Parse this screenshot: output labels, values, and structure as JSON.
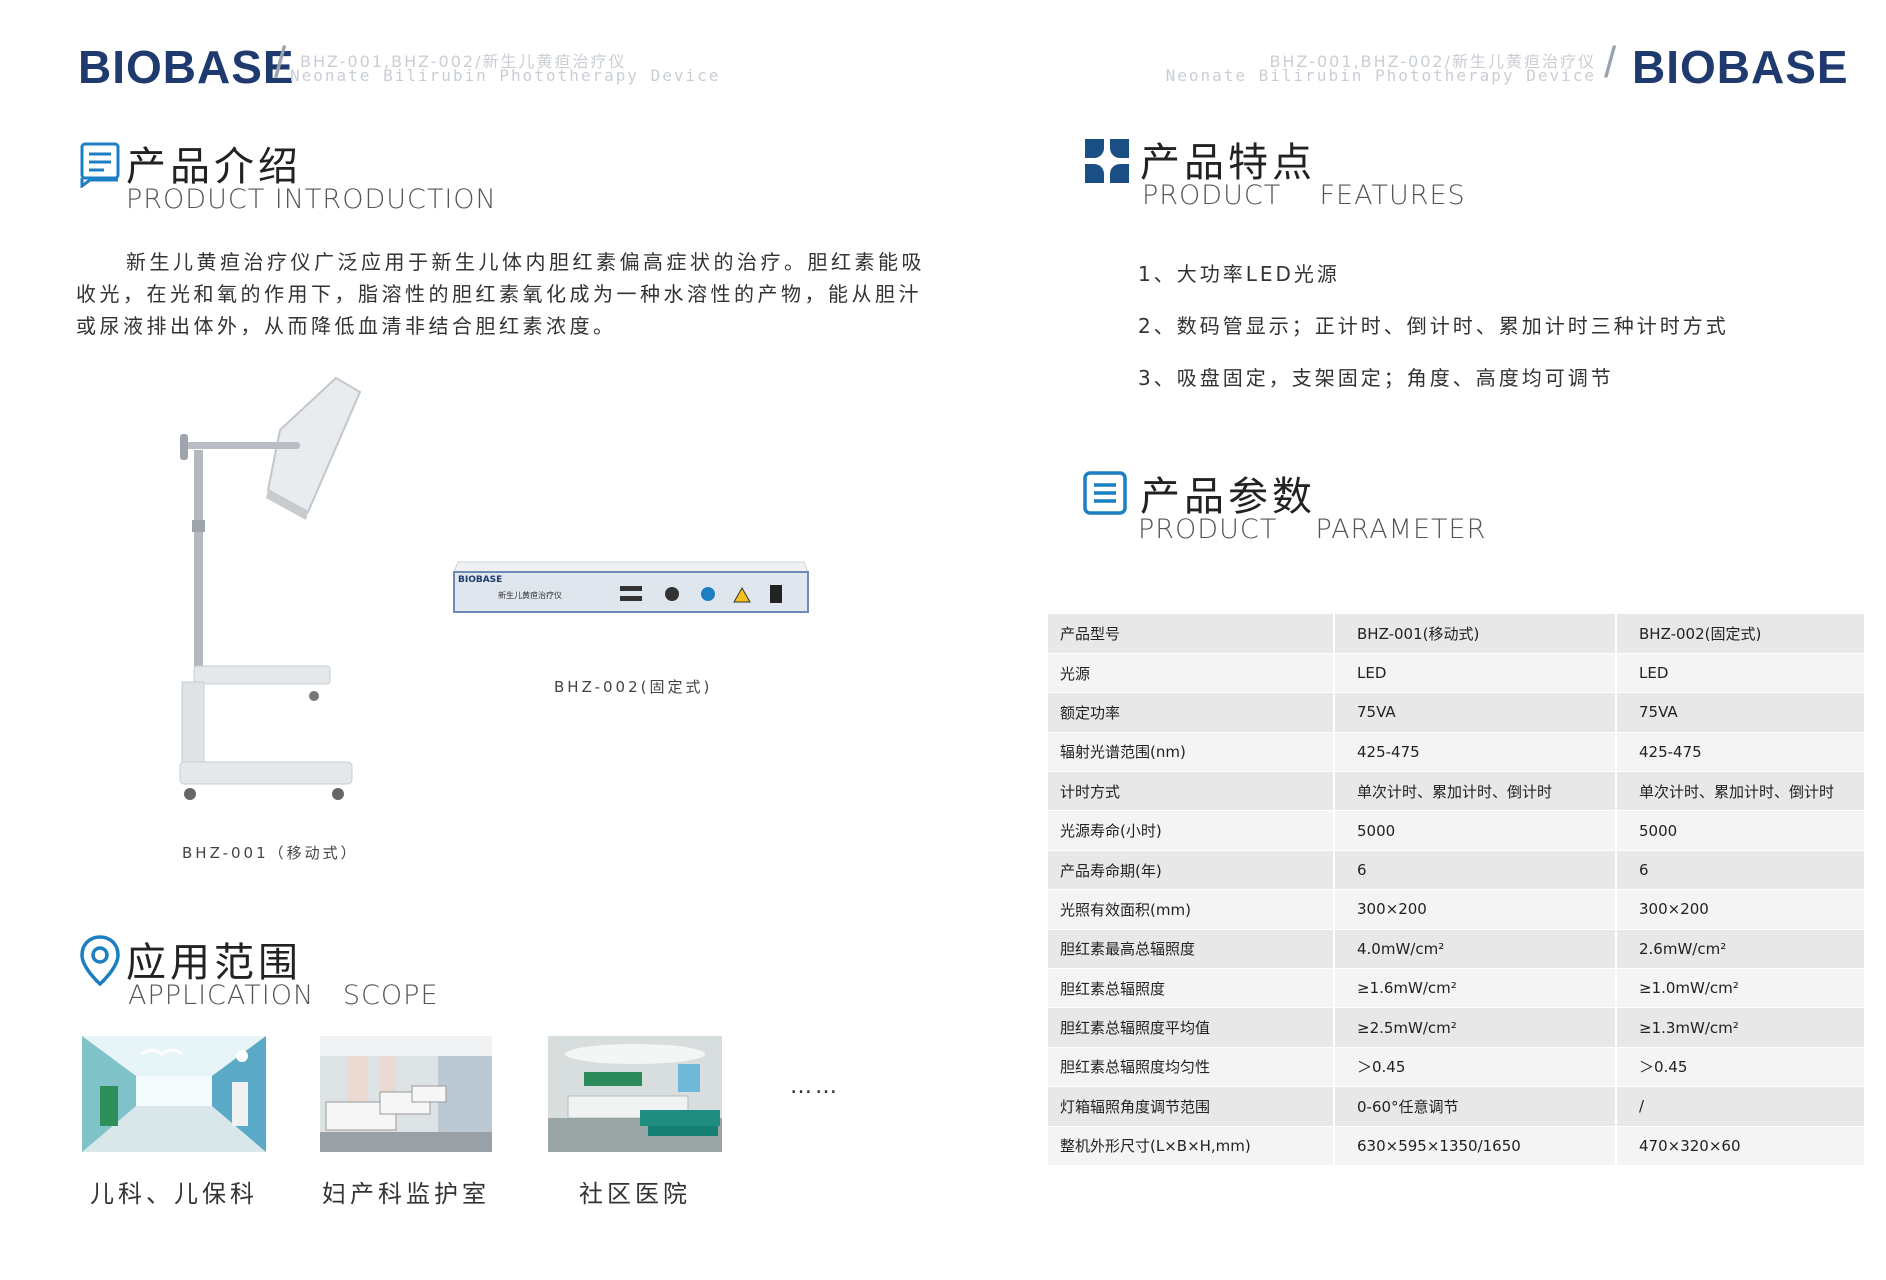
{
  "header": {
    "left": {
      "logo": "BIOBASE",
      "slash": "/",
      "line1": "BHZ-001,BHZ-002/新生儿黄疸治疗仪",
      "line2": "Neonate Bilirubin Phototherapy Device"
    },
    "right": {
      "logo": "BIOBASE",
      "slash": "/",
      "line1": "BHZ-001,BHZ-002/新生儿黄疸治疗仪",
      "line2": "Neonate Bilirubin Phototherapy Device"
    }
  },
  "intro": {
    "title_zh": "产品介绍",
    "title_en": "PRODUCT INTRODUCTION",
    "paragraph": "新生儿黄疸治疗仪广泛应用于新生儿体内胆红素偏高症状的治疗。胆红素能吸收光，在光和氧的作用下，脂溶性的胆红素氧化成为一种水溶性的产物，能从胆汁或尿液排出体外，从而降低血清非结合胆红素浓度。"
  },
  "products": {
    "mobile_caption": "BHZ-001（移动式）",
    "fixed_caption": "BHZ-002(固定式)",
    "device_brand": "BIOBASE",
    "device_name": "新生儿黄疸治疗仪"
  },
  "features": {
    "title_zh": "产品特点",
    "title_en": "PRODUCT    FEATURES",
    "items": [
      "1、大功率LED光源",
      "2、数码管显示；正计时、倒计时、累加计时三种计时方式",
      "3、吸盘固定，支架固定；角度、高度均可调节"
    ]
  },
  "parameters": {
    "title_zh": "产品参数",
    "title_en": "PRODUCT    PARAMETER",
    "rows": [
      [
        "产品型号",
        "BHZ-001(移动式)",
        "BHZ-002(固定式)"
      ],
      [
        "光源",
        "LED",
        "LED"
      ],
      [
        "额定功率",
        "75VA",
        "75VA"
      ],
      [
        "辐射光谱范围(nm)",
        "425-475",
        "425-475"
      ],
      [
        "计时方式",
        "单次计时、累加计时、倒计时",
        "单次计时、累加计时、倒计时"
      ],
      [
        "光源寿命(小时)",
        "5000",
        "5000"
      ],
      [
        "产品寿命期(年)",
        "6",
        "6"
      ],
      [
        "光照有效面积(mm)",
        "300×200",
        "300×200"
      ],
      [
        "胆红素最高总辐照度",
        "4.0mW/cm²",
        "2.6mW/cm²"
      ],
      [
        "胆红素总辐照度",
        "≥1.6mW/cm²",
        "≥1.0mW/cm²"
      ],
      [
        "胆红素总辐照度平均值",
        "≥2.5mW/cm²",
        "≥1.3mW/cm²"
      ],
      [
        "胆红素总辐照度均匀性",
        "＞0.45",
        "＞0.45"
      ],
      [
        "灯箱辐照角度调节范围",
        "0-60°任意调节",
        "/"
      ],
      [
        "整机外形尺寸(L×B×H,mm)",
        "630×595×1350/1650",
        "470×320×60"
      ]
    ]
  },
  "scope": {
    "title_zh": "应用范围",
    "title_en": "APPLICATION   SCOPE",
    "items": [
      {
        "label": "儿科、儿保科"
      },
      {
        "label": "妇产科监护室"
      },
      {
        "label": "社区医院"
      }
    ],
    "ellipsis": "……"
  },
  "colors": {
    "brand_navy": "#1e3a6e",
    "icon_blue": "#1c7fc4",
    "features_icon": "#1a4f86",
    "table_odd": "#e8e8e8",
    "table_even": "#f4f4f4"
  }
}
